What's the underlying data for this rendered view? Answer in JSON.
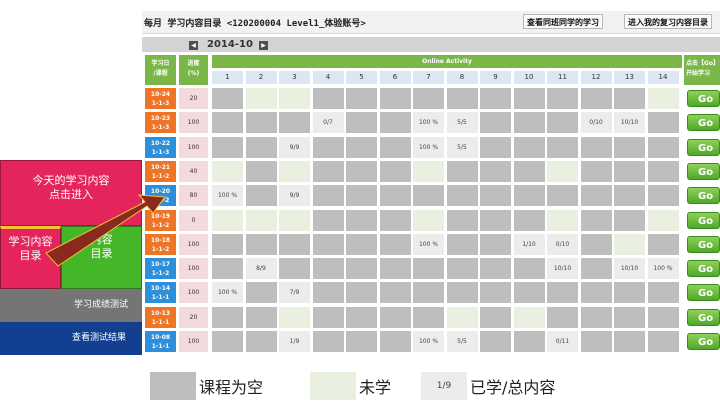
{
  "left_menu": {
    "today_line1": "今天的学习内容",
    "today_line2": "点击进入",
    "catalog_line1": "学习内容",
    "catalog_line2": "目录",
    "review_line1": "内容",
    "review_line2": "目录",
    "test_scores": "学习成绩测试",
    "view_results": "查看测试结果",
    "colors": {
      "pink": "#e4245a",
      "green": "#46b629",
      "gray": "#757575",
      "navy": "#123f8f"
    }
  },
  "window": {
    "title": "每月 学习内容目录  <120200004 Level1_体验账号>",
    "btn_classmates": "查看同班同学的学习",
    "btn_review": "进入我的复习内容目录"
  },
  "month": {
    "label": "2014-10",
    "prev": "◀",
    "next": "▶"
  },
  "table": {
    "header_date": [
      "学习日",
      "/课程"
    ],
    "header_progress": [
      "进度",
      "(%)"
    ],
    "header_activity": "Online Activity",
    "header_go": [
      "点击【Go】",
      "开始学习"
    ],
    "columns": [
      "1",
      "2",
      "3",
      "4",
      "5",
      "6",
      "7",
      "8",
      "9",
      "10",
      "11",
      "12",
      "13",
      "14"
    ],
    "go_label": "Go",
    "rows": [
      {
        "date": "10-24",
        "course": "1-1-3",
        "badge": "orange",
        "progress": "20",
        "cells": [
          "G",
          "E",
          "E",
          "G",
          "G",
          "G",
          "G",
          "G",
          "G",
          "G",
          "G",
          "G",
          "G",
          "E"
        ]
      },
      {
        "date": "10-23",
        "course": "1-1-3",
        "badge": "orange",
        "progress": "100",
        "cells": [
          "G",
          "G",
          "G",
          "0/7",
          "G",
          "G",
          "100 %",
          "5/5",
          "G",
          "G",
          "G",
          "0/10",
          "10/10",
          "G"
        ]
      },
      {
        "date": "10-22",
        "course": "1-1-3",
        "badge": "blue",
        "progress": "100",
        "cells": [
          "G",
          "G",
          "9/9",
          "G",
          "G",
          "G",
          "100 %",
          "5/5",
          "G",
          "G",
          "G",
          "G",
          "G",
          "G"
        ]
      },
      {
        "date": "10-21",
        "course": "1-1-2",
        "badge": "orange",
        "progress": "40",
        "cells": [
          "E",
          "G",
          "E",
          "G",
          "G",
          "G",
          "E",
          "G",
          "G",
          "G",
          "E",
          "G",
          "G",
          "G"
        ]
      },
      {
        "date": "10-20",
        "course": "1-1-2",
        "badge": "blue",
        "progress": "80",
        "cells": [
          "100 %",
          "G",
          "9/9",
          "G",
          "G",
          "G",
          "G",
          "G",
          "G",
          "G",
          "G",
          "G",
          "G",
          "G"
        ]
      },
      {
        "date": "10-19",
        "course": "1-1-2",
        "badge": "orange",
        "progress": "0",
        "cells": [
          "E",
          "E",
          "E",
          "G",
          "G",
          "G",
          "E",
          "G",
          "G",
          "G",
          "E",
          "G",
          "G",
          "E"
        ]
      },
      {
        "date": "10-18",
        "course": "1-1-2",
        "badge": "orange",
        "progress": "100",
        "cells": [
          "G",
          "G",
          "G",
          "G",
          "G",
          "G",
          "100 %",
          "G",
          "G",
          "1/10",
          "0/10",
          "G",
          "E",
          "G"
        ]
      },
      {
        "date": "10-17",
        "course": "1-1-2",
        "badge": "blue",
        "progress": "100",
        "cells": [
          "G",
          "8/9",
          "G",
          "G",
          "G",
          "G",
          "G",
          "G",
          "G",
          "G",
          "10/10",
          "G",
          "10/10",
          "100 %"
        ]
      },
      {
        "date": "10-14",
        "course": "1-1-1",
        "badge": "blue",
        "progress": "100",
        "cells": [
          "100 %",
          "G",
          "7/9",
          "G",
          "G",
          "G",
          "G",
          "G",
          "G",
          "G",
          "G",
          "G",
          "G",
          "G"
        ]
      },
      {
        "date": "10-13",
        "course": "1-1-1",
        "badge": "orange",
        "progress": "20",
        "cells": [
          "G",
          "G",
          "E",
          "G",
          "G",
          "G",
          "G",
          "E",
          "G",
          "E",
          "G",
          "G",
          "G",
          "G"
        ]
      },
      {
        "date": "10-08",
        "course": "1-1-1",
        "badge": "blue",
        "progress": "100",
        "cells": [
          "G",
          "G",
          "1/9",
          "G",
          "G",
          "G",
          "100 %",
          "5/5",
          "G",
          "G",
          "0/11",
          "G",
          "G",
          "G"
        ]
      }
    ]
  },
  "legend": {
    "empty_label": "课程为空",
    "unlearned_label": "未学",
    "sample_ratio": "1/9",
    "learned_label": "已学/总内容"
  },
  "colors": {
    "cell_gray": "#bebebe",
    "cell_empty": "#e9f0df",
    "cell_value": "#ececec",
    "badge_orange": "#ee7426",
    "badge_blue": "#2d8fd9",
    "header_green": "#7ab648"
  }
}
